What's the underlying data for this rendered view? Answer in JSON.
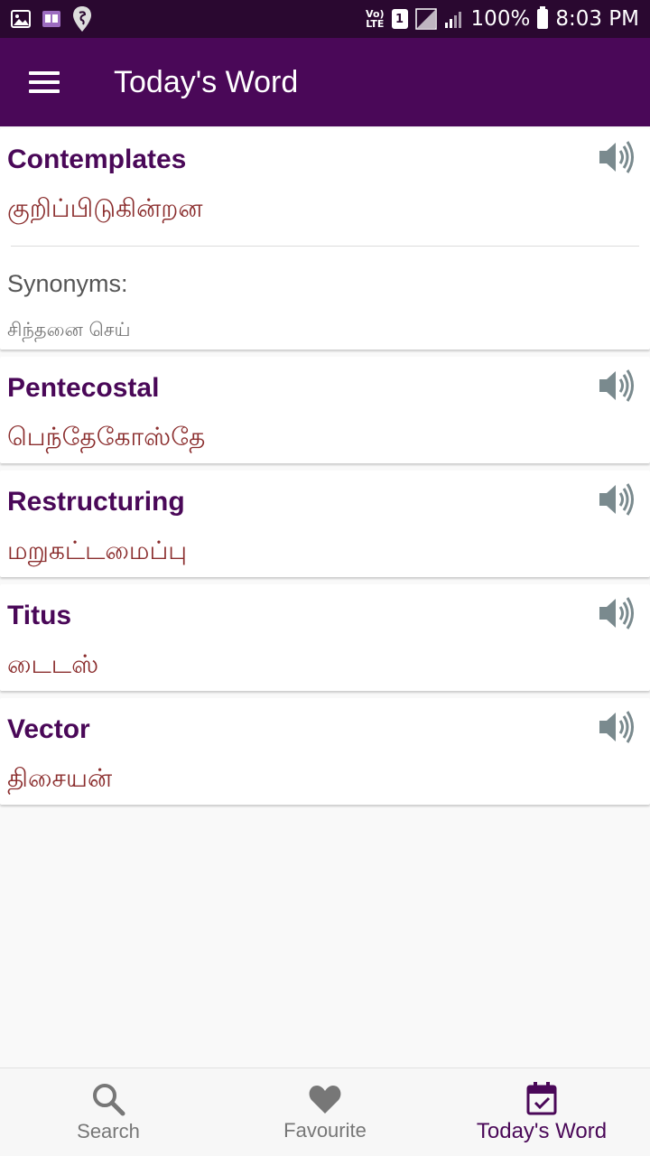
{
  "status_bar": {
    "volte_top": "Vo)",
    "volte_bottom": "LTE",
    "sim_slot": "1",
    "battery": "100%",
    "time": "8:03 PM"
  },
  "app_bar": {
    "title": "Today's Word",
    "menu_icon": "hamburger-icon"
  },
  "words": [
    {
      "word": "Contemplates",
      "translation": "குறிப்பிடுகின்றன",
      "synonyms_label": "Synonyms:",
      "synonyms": "சிந்தனை செய்"
    },
    {
      "word": "Pentecostal",
      "translation": "பெந்தேகோஸ்தே"
    },
    {
      "word": "Restructuring",
      "translation": "மறுகட்டமைப்பு"
    },
    {
      "word": "Titus",
      "translation": "டைடஸ்"
    },
    {
      "word": "Vector",
      "translation": "திசையன்"
    }
  ],
  "bottom_nav": {
    "items": [
      {
        "label": "Search",
        "icon": "search-icon",
        "active": false
      },
      {
        "label": "Favourite",
        "icon": "heart-icon",
        "active": false
      },
      {
        "label": "Today's Word",
        "icon": "calendar-check-icon",
        "active": true
      }
    ]
  },
  "colors": {
    "status_bar": "#2a0830",
    "app_bar": "#4a0858",
    "word": "#4a0858",
    "translation": "#8b2e2e",
    "background": "#f9f9f9"
  }
}
